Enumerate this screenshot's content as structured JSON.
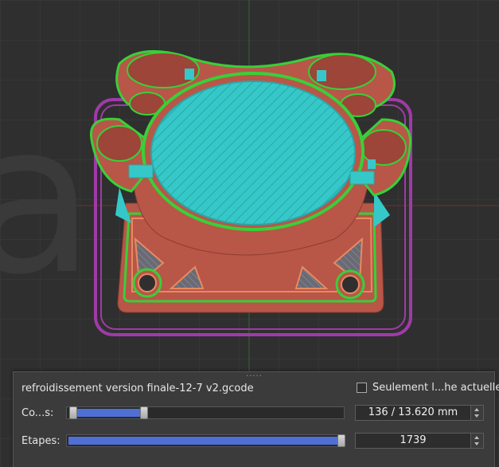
{
  "viewport": {
    "label": "gcode-3d-preview",
    "background_letters": "a a",
    "colors": {
      "background": "#2f2f2f",
      "outer_perimeter": "#b85648",
      "inner_perimeter": "#38d038",
      "top_infill": "#36c8c8",
      "skirt": "#a03aa8",
      "solid_infill": "#e88a60"
    }
  },
  "panel": {
    "filename": "refroidissement version finale-12-7 v2.gcode",
    "current_layer_only_label": "Seulement l...he actuelle",
    "current_layer_only_checked": false,
    "layers": {
      "label": "Co...s:",
      "value_text": "136 / 13.620 mm",
      "range_low": 0.01,
      "range_high": 0.27
    },
    "steps": {
      "label": "Etapes:",
      "value_text": "1739",
      "position": 1.0
    }
  }
}
